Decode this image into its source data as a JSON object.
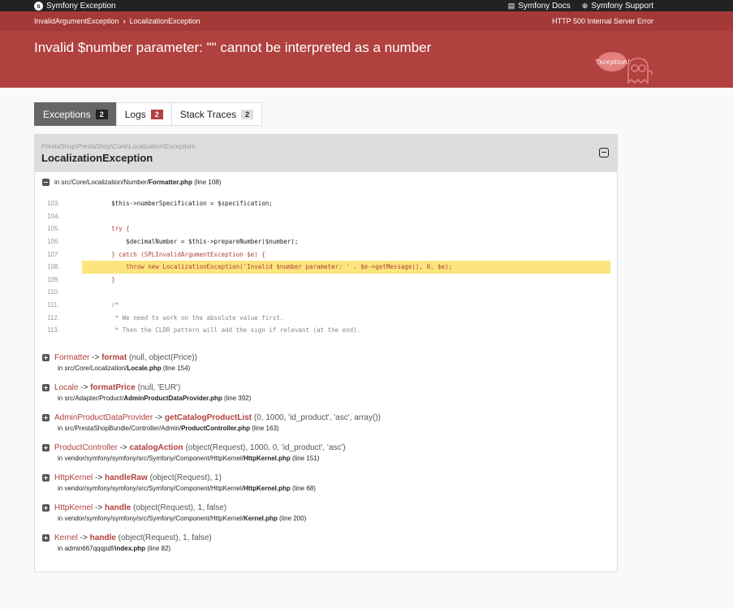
{
  "topbar": {
    "brand": "Symfony Exception",
    "docs": "Symfony Docs",
    "support": "Symfony Support"
  },
  "breadcrumbs": {
    "first": "InvalidArgumentException",
    "second": "LocalizationException",
    "status": "HTTP 500 Internal Server Error"
  },
  "error_message": "Invalid $number parameter: \"\" cannot be interpreted as a number",
  "ghost_text": "Exception!",
  "tabs": [
    {
      "label": "Exceptions",
      "count": "2"
    },
    {
      "label": "Logs",
      "count": "2"
    },
    {
      "label": "Stack Traces",
      "count": "2"
    }
  ],
  "exception": {
    "namespace": "PrestaShop\\PrestaShop\\Core\\Localization\\Exception\\",
    "class": "LocalizationException",
    "location_prefix": "in src/Core/Localization/Number/",
    "location_file": "Formatter.php",
    "location_suffix": "(line 108)"
  },
  "code_lines": [
    {
      "n": "103.",
      "code": "        $this->numberSpecification = $specification;"
    },
    {
      "n": "104.",
      "code": ""
    },
    {
      "n": "105.",
      "code": "        try {"
    },
    {
      "n": "106.",
      "code": "            $decimalNumber = $this->prepareNumber($number);"
    },
    {
      "n": "107.",
      "code": "        } catch (SPLInvalidArgumentException $e) {"
    },
    {
      "n": "108.",
      "code": "            throw new LocalizationException('Invalid $number parameter: ' . $e->getMessage(), 0, $e);"
    },
    {
      "n": "109.",
      "code": "        }"
    },
    {
      "n": "110.",
      "code": ""
    },
    {
      "n": "111.",
      "code": "        /*"
    },
    {
      "n": "112.",
      "code": "         * We need to work on the absolute value first."
    },
    {
      "n": "113.",
      "code": "         * Then the CLDR pattern will add the sign if relevant (at the end)."
    }
  ],
  "frames": [
    {
      "cls": "Formatter",
      "fn": "format",
      "args": "(null, object(Price))",
      "path": "in src/Core/Localization/",
      "file": "Locale.php",
      "line": "(line 154)"
    },
    {
      "cls": "Locale",
      "fn": "formatPrice",
      "args": "(null, 'EUR')",
      "path": "in src/Adapter/Product/",
      "file": "AdminProductDataProvider.php",
      "line": "(line 392)"
    },
    {
      "cls": "AdminProductDataProvider",
      "fn": "getCatalogProductList",
      "args": "(0, 1000, 'id_product', 'asc', array())",
      "path": "in src/PrestaShopBundle/Controller/Admin/",
      "file": "ProductController.php",
      "line": "(line 163)"
    },
    {
      "cls": "ProductController",
      "fn": "catalogAction",
      "args": "(object(Request), 1000, 0, 'id_product', 'asc')",
      "path": "in vendor/symfony/symfony/src/Symfony/Component/HttpKernel/",
      "file": "HttpKernel.php",
      "line": "(line 151)"
    },
    {
      "cls": "HttpKernel",
      "fn": "handleRaw",
      "args": "(object(Request), 1)",
      "path": "in vendor/symfony/symfony/src/Symfony/Component/HttpKernel/",
      "file": "HttpKernel.php",
      "line": "(line 68)"
    },
    {
      "cls": "HttpKernel",
      "fn": "handle",
      "args": "(object(Request), 1, false)",
      "path": "in vendor/symfony/symfony/src/Symfony/Component/HttpKernel/",
      "file": "Kernel.php",
      "line": "(line 200)"
    },
    {
      "cls": "Kernel",
      "fn": "handle",
      "args": "(object(Request), 1, false)",
      "path": "in admin667qqqpdf/",
      "file": "index.php",
      "line": "(line 82)"
    }
  ],
  "icons": {
    "brand": "symfony-logo-icon",
    "docs": "book-icon",
    "support": "lifebuoy-icon",
    "collapse": "minus-square-icon",
    "expand": "plus-square-icon"
  },
  "colors": {
    "header": "#b0413e",
    "highlight": "#fbe57c"
  }
}
